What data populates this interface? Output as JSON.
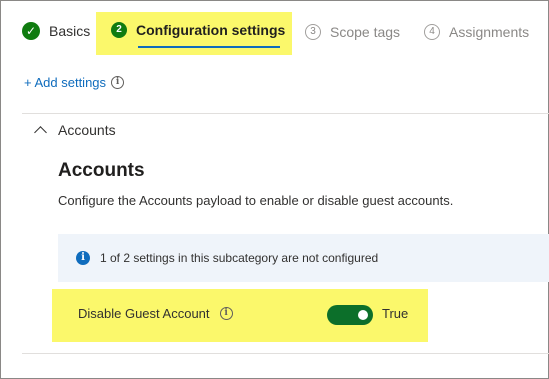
{
  "wizard": {
    "steps": [
      {
        "label": "Basics",
        "number": "",
        "state": "completed"
      },
      {
        "label": "Configuration settings",
        "number": "2",
        "state": "active"
      },
      {
        "label": "Scope tags",
        "number": "3",
        "state": "upcoming"
      },
      {
        "label": "Assignments",
        "number": "4",
        "state": "upcoming"
      }
    ]
  },
  "add_settings": {
    "label": "+ Add settings"
  },
  "section": {
    "header": "Accounts",
    "title": "Accounts",
    "description": "Configure the Accounts payload to enable or disable guest accounts."
  },
  "info_bar": {
    "text": "1 of 2 settings in this subcategory are not configured"
  },
  "setting": {
    "label": "Disable Guest Account",
    "toggle_on": true,
    "value": "True"
  },
  "colors": {
    "accent": "#0f6cbd",
    "success": "#107c10",
    "toggle": "#0c6f2a",
    "highlight": "#fbf86b"
  }
}
